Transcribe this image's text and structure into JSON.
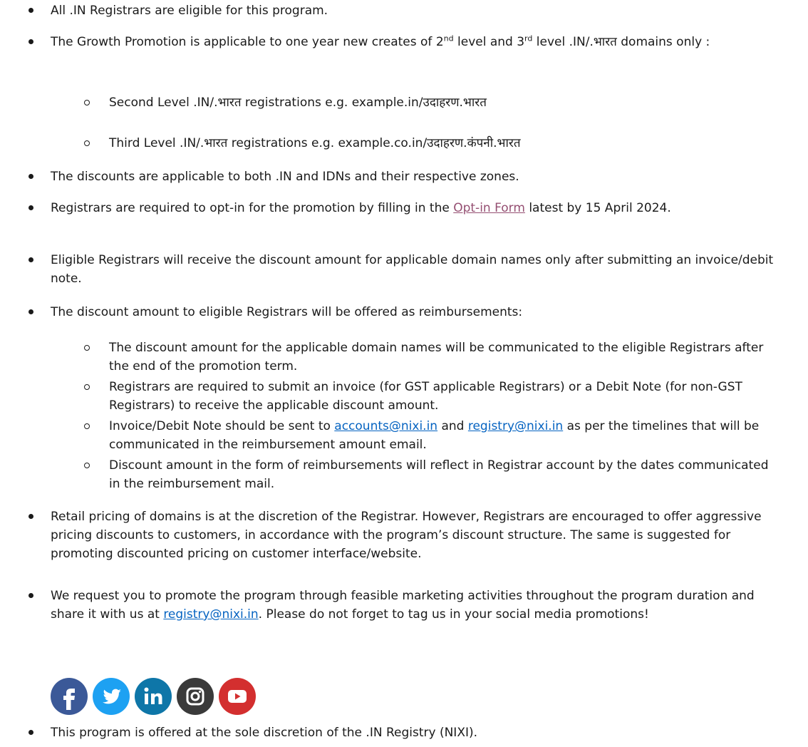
{
  "items": [
    {
      "text": "All .IN Registrars are eligible for this program."
    },
    {
      "pre": "The Growth Promotion is applicable to one year new creates of 2",
      "sup1": "nd",
      "mid": " level and 3",
      "sup2": "rd",
      "post": " level .IN/.भारत domains only :"
    },
    {
      "sub_a": "Second Level .IN/.भारत registrations e.g. example.in/उदाहरण.भारत"
    },
    {
      "sub_b": "Third Level .IN/.भारत registrations e.g. example.co.in/उदाहरण.कंपनी.भारत"
    },
    {
      "text": "The discounts are applicable to both .IN and IDNs and their respective zones."
    },
    {
      "pre": "Registrars are required to opt-in for the promotion by filling in the ",
      "link": "Opt-in Form",
      "post": " latest by 15 April 2024."
    },
    {
      "text": "Eligible Registrars will receive the discount amount for applicable domain names only after submitting an invoice/debit note."
    },
    {
      "text": "The discount amount to eligible Registrars will be offered as reimbursements:"
    },
    {
      "sub_c": "The discount amount for the applicable domain names will be communicated to the eligible Registrars after the end of the promotion term."
    },
    {
      "sub_d": "Registrars are required to submit an invoice (for GST applicable Registrars) or a Debit Note (for non-GST Registrars) to receive the applicable discount amount."
    },
    {
      "pre": "Invoice/Debit Note should be sent to ",
      "link1": "accounts@nixi.in",
      "mid": " and ",
      "link2": "registry@nixi.in",
      "post": " as per the timelines that will be communicated in the reimbursement amount email."
    },
    {
      "sub_e": "Discount amount in the form of reimbursements will reflect in Registrar account by the dates communicated in the reimbursement mail."
    },
    {
      "text": "Retail pricing of domains is at the discretion of the Registrar. However, Registrars are encouraged to offer aggressive pricing discounts to customers, in accordance with the program’s discount structure. The same is suggested for promoting discounted pricing on customer interface/website."
    },
    {
      "pre": "We request you to promote the program through feasible marketing activities throughout the program duration and share it with us at ",
      "link": "registry@nixi.in",
      "post": ". Please do not forget to tag us in your social media promotions!"
    },
    {
      "text": "This program is offered at the sole discretion of the .IN Registry (NIXI)."
    }
  ],
  "social_icons": [
    {
      "name": "facebook-icon",
      "color": "#3b5998"
    },
    {
      "name": "twitter-icon",
      "color": "#1da1f2"
    },
    {
      "name": "linkedin-icon",
      "color": "#0e76a8"
    },
    {
      "name": "instagram-icon",
      "color": "#3a3a3a"
    },
    {
      "name": "youtube-icon",
      "color": "#d32f2f"
    }
  ]
}
